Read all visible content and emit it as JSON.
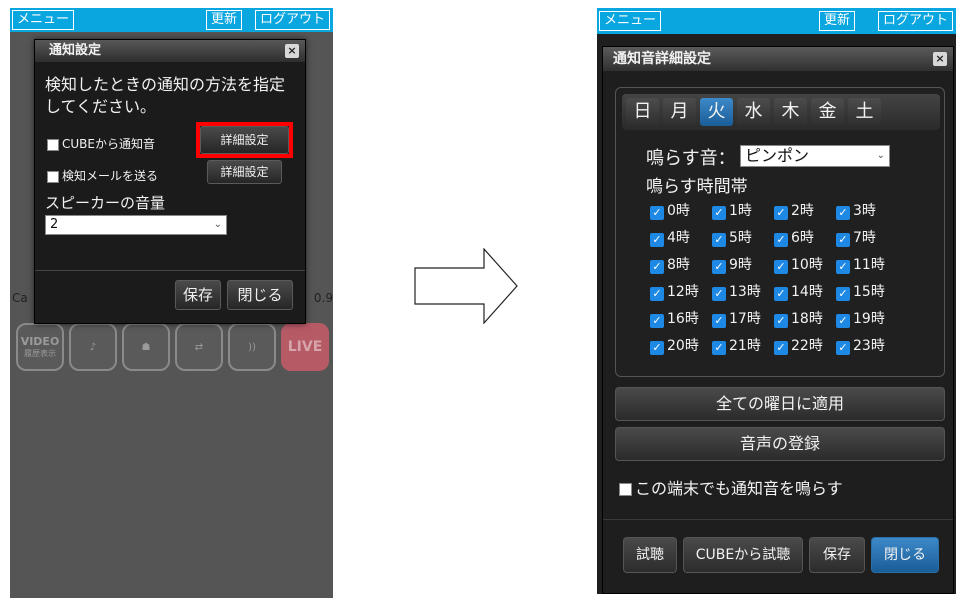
{
  "left": {
    "topbar": {
      "menu": "メニュー",
      "refresh": "更新",
      "logout": "ログアウト"
    },
    "background": {
      "left_label": "Ca",
      "right_label": "0.9"
    },
    "tools": {
      "video_label": "VIDEO",
      "video_sub": "履歴表示",
      "live_label": "LIVE"
    },
    "dialog": {
      "title": "通知設定",
      "close": "×",
      "description": "検知したときの通知の方法を指定してください。",
      "cube_sound_label": "CUBEから通知音",
      "mail_label": "検知メールを送る",
      "detail_button": "詳細設定",
      "speaker_label": "スピーカーの音量",
      "volume_value": "2",
      "save": "保存",
      "close_button": "閉じる"
    }
  },
  "right": {
    "topbar": {
      "menu": "メニュー",
      "refresh": "更新",
      "logout": "ログアウト"
    },
    "dialog": {
      "title": "通知音詳細設定",
      "close": "×",
      "days": [
        "日",
        "月",
        "火",
        "水",
        "木",
        "金",
        "土"
      ],
      "active_day": "火",
      "sound_label": "鳴らす音：",
      "sound_value": "ピンポン",
      "time_label": "鳴らす時間帯",
      "hours": [
        "0時",
        "1時",
        "2時",
        "3時",
        "4時",
        "5時",
        "6時",
        "7時",
        "8時",
        "9時",
        "10時",
        "11時",
        "12時",
        "13時",
        "14時",
        "15時",
        "16時",
        "17時",
        "18時",
        "19時",
        "20時",
        "21時",
        "22時",
        "23時"
      ],
      "apply_all": "全ての曜日に適用",
      "register_voice": "音声の登録",
      "terminal_sound": "この端末でも通知音を鳴らす",
      "footer": {
        "listen": "試聴",
        "cube_listen": "CUBEから試聴",
        "save": "保存",
        "close": "閉じる"
      }
    }
  },
  "colors": {
    "accent": "#0aa6e0",
    "active": "#1e88e5",
    "highlight": "#ff0000"
  }
}
